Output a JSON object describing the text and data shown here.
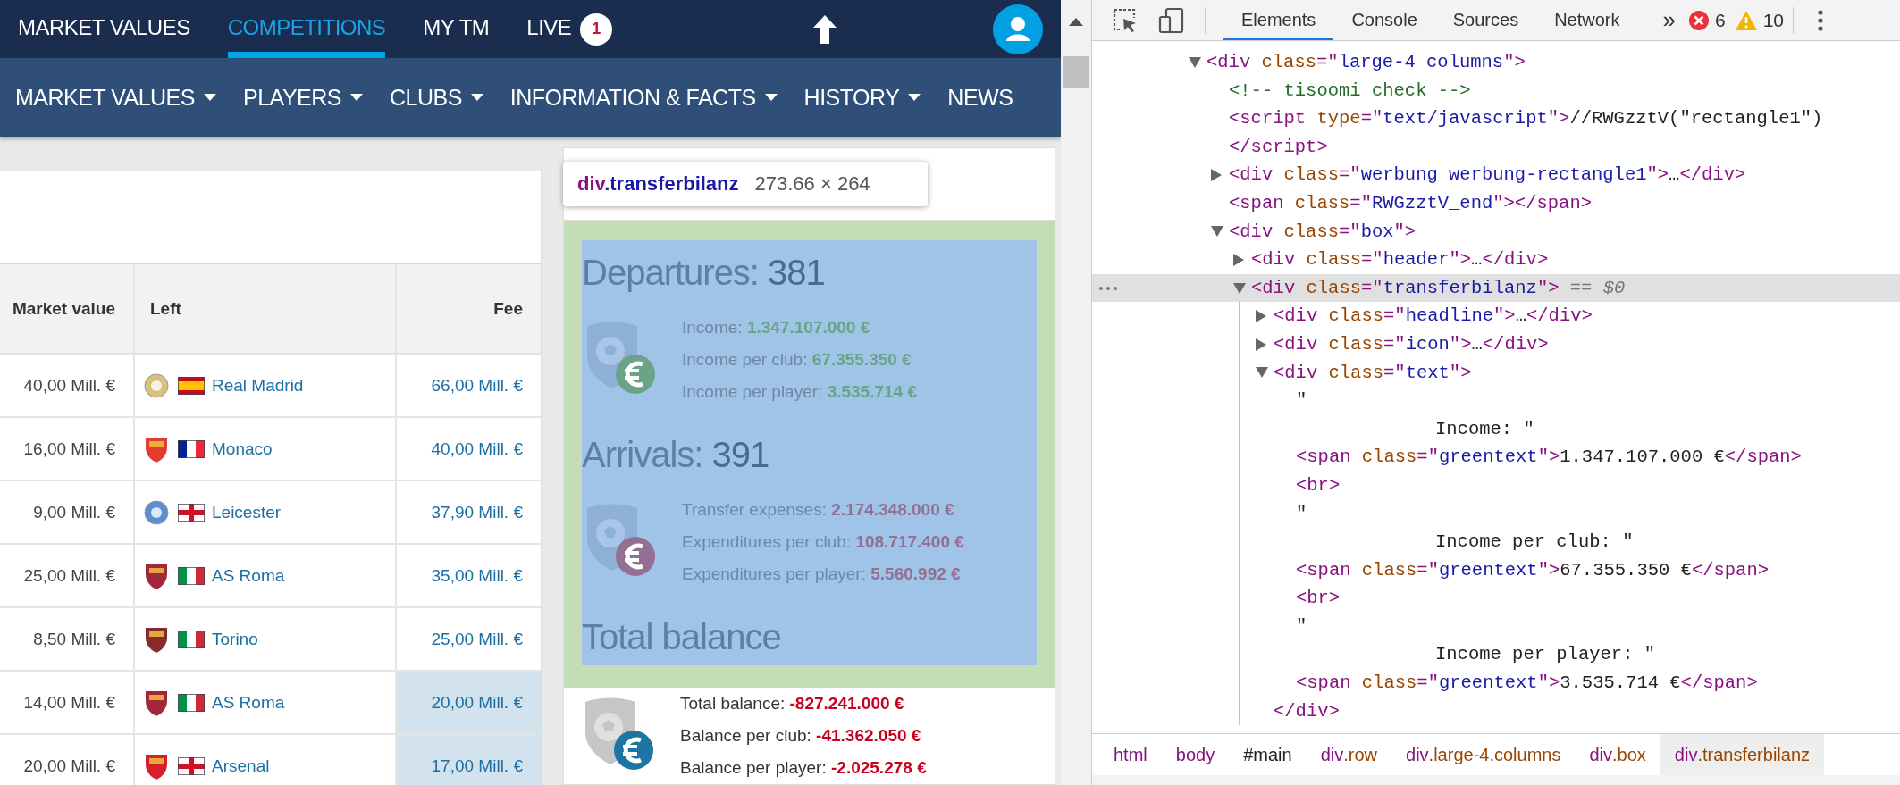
{
  "top_nav": {
    "items": [
      {
        "label": "MARKET VALUES",
        "selected": false
      },
      {
        "label": "COMPETITIONS",
        "selected": true
      },
      {
        "label": "MY TM",
        "selected": false
      },
      {
        "label": "LIVE",
        "selected": false,
        "badge": "1"
      }
    ]
  },
  "sub_nav": {
    "items": [
      {
        "label": "MARKET VALUES",
        "dropdown": true
      },
      {
        "label": "PLAYERS",
        "dropdown": true
      },
      {
        "label": "CLUBS",
        "dropdown": true
      },
      {
        "label": "INFORMATION & FACTS",
        "dropdown": true
      },
      {
        "label": "HISTORY",
        "dropdown": true
      },
      {
        "label": "NEWS",
        "dropdown": false
      }
    ]
  },
  "transfer_table": {
    "columns": [
      "Market value",
      "Left",
      "Fee"
    ],
    "rows": [
      {
        "market_value": "40,00 Mill. €",
        "color": "#d8c27a",
        "club": "Real Madrid",
        "fee": "66,00 Mill. €",
        "highlighted": false
      },
      {
        "market_value": "16,00 Mill. €",
        "color": "#e03c31",
        "club": "Monaco",
        "fee": "40,00 Mill. €",
        "highlighted": false
      },
      {
        "market_value": "9,00 Mill. €",
        "color": "#5b8fd0",
        "club": "Leicester",
        "fee": "37,90 Mill. €",
        "highlighted": false
      },
      {
        "market_value": "25,00 Mill. €",
        "color": "#a3273a",
        "club": "AS Roma",
        "fee": "35,00 Mill. €",
        "highlighted": false
      },
      {
        "market_value": "8,50 Mill. €",
        "color": "#8b2a2a",
        "club": "Torino",
        "fee": "25,00 Mill. €",
        "highlighted": false
      },
      {
        "market_value": "14,00 Mill. €",
        "color": "#a3273b",
        "club": "AS Roma",
        "fee": "20,00 Mill. €",
        "highlighted": true
      },
      {
        "market_value": "20,00 Mill. €",
        "color": "#d4202a",
        "club": "Arsenal",
        "fee": "17,00 Mill. €",
        "highlighted": true
      }
    ]
  },
  "transfer_balance": {
    "tooltip": {
      "tag": "div",
      "class_name": ".transferbilanz",
      "size": "273.66 × 264"
    },
    "departures": {
      "title": "Departures:",
      "count": "381",
      "color": "#6aa387",
      "lines": [
        {
          "label": "Income:",
          "value": "1.347.107.000 €"
        },
        {
          "label": "Income per club:",
          "value": "67.355.350 €"
        },
        {
          "label": "Income per player:",
          "value": "3.535.714 €"
        }
      ]
    },
    "arrivals": {
      "title": "Arrivals:",
      "count": "391",
      "color": "#936f93",
      "lines": [
        {
          "label": "Transfer expenses:",
          "value": "2.174.348.000 €"
        },
        {
          "label": "Expenditures per club:",
          "value": "108.717.400 €"
        },
        {
          "label": "Expenditures per player:",
          "value": "5.560.992 €"
        }
      ]
    },
    "total": {
      "title": "Total balance",
      "color": "#c8001e",
      "lines": [
        {
          "label": "Total balance:",
          "value": "-827.241.000 €"
        },
        {
          "label": "Balance per club:",
          "value": "-41.362.050 €"
        },
        {
          "label": "Balance per player:",
          "value": "-2.025.278 €"
        }
      ]
    }
  },
  "devtools": {
    "tabs": [
      {
        "label": "Elements",
        "selected": true
      },
      {
        "label": "Console",
        "selected": false
      },
      {
        "label": "Sources",
        "selected": false
      },
      {
        "label": "Network",
        "selected": false
      }
    ],
    "more_tabs": "»",
    "errors": "6",
    "warnings": "10",
    "tree": [
      {
        "kind": "element",
        "selected": false,
        "expanded": true,
        "tokens": [
          {
            "kind": "tag",
            "text": "<div"
          },
          {
            "kind": "attr",
            "text": " class"
          },
          {
            "kind": "tag",
            "text": "=\""
          },
          {
            "kind": "value",
            "text": "large-4 columns"
          },
          {
            "kind": "tag",
            "text": "\">"
          }
        ],
        "children": [
          {
            "kind": "comment",
            "selected": false,
            "tokens": [
              {
                "kind": "comment",
                "text": "<!-- tisoomi check -->"
              }
            ]
          },
          {
            "kind": "element",
            "selected": false,
            "tokens": [
              {
                "kind": "tag",
                "text": "<script"
              },
              {
                "kind": "attr",
                "text": " type"
              },
              {
                "kind": "tag",
                "text": "=\""
              },
              {
                "kind": "value",
                "text": "text/javascript"
              },
              {
                "kind": "tag",
                "text": "\">"
              },
              {
                "kind": "plain",
                "text": "//RWGzztV(\"rectangle1\")"
              }
            ],
            "closing": [
              {
                "kind": "tag",
                "text": "</script>"
              }
            ]
          },
          {
            "kind": "element",
            "selected": false,
            "expanded": false,
            "tokens": [
              {
                "kind": "tag",
                "text": "<div"
              },
              {
                "kind": "attr",
                "text": " class"
              },
              {
                "kind": "tag",
                "text": "=\""
              },
              {
                "kind": "value",
                "text": "werbung werbung-rectangle1"
              },
              {
                "kind": "tag",
                "text": "\">"
              },
              {
                "kind": "plain",
                "text": "…"
              },
              {
                "kind": "tag",
                "text": "</div>"
              }
            ]
          },
          {
            "kind": "element",
            "selected": false,
            "tokens": [
              {
                "kind": "tag",
                "text": "<span"
              },
              {
                "kind": "attr",
                "text": " class"
              },
              {
                "kind": "tag",
                "text": "=\""
              },
              {
                "kind": "value",
                "text": "RWGzztV_end"
              },
              {
                "kind": "tag",
                "text": "\"></span>"
              }
            ]
          },
          {
            "kind": "element",
            "selected": false,
            "expanded": true,
            "tokens": [
              {
                "kind": "tag",
                "text": "<div"
              },
              {
                "kind": "attr",
                "text": " class"
              },
              {
                "kind": "tag",
                "text": "=\""
              },
              {
                "kind": "value",
                "text": "box"
              },
              {
                "kind": "tag",
                "text": "\">"
              }
            ],
            "children": [
              {
                "kind": "element",
                "selected": false,
                "expanded": false,
                "tokens": [
                  {
                    "kind": "tag",
                    "text": "<div"
                  },
                  {
                    "kind": "attr",
                    "text": " class"
                  },
                  {
                    "kind": "tag",
                    "text": "=\""
                  },
                  {
                    "kind": "value",
                    "text": "header"
                  },
                  {
                    "kind": "tag",
                    "text": "\">"
                  },
                  {
                    "kind": "plain",
                    "text": "…"
                  },
                  {
                    "kind": "tag",
                    "text": "</div>"
                  }
                ]
              },
              {
                "kind": "element",
                "selected": true,
                "expanded": true,
                "tokens": [
                  {
                    "kind": "tag",
                    "text": "<div"
                  },
                  {
                    "kind": "attr",
                    "text": " class"
                  },
                  {
                    "kind": "tag",
                    "text": "=\""
                  },
                  {
                    "kind": "value",
                    "text": "transferbilanz"
                  },
                  {
                    "kind": "tag",
                    "text": "\">"
                  },
                  {
                    "kind": "meta",
                    "text": " == $0"
                  }
                ],
                "children": [
                  {
                    "kind": "element",
                    "selected": false,
                    "expanded": false,
                    "tokens": [
                      {
                        "kind": "tag",
                        "text": "<div"
                      },
                      {
                        "kind": "attr",
                        "text": " class"
                      },
                      {
                        "kind": "tag",
                        "text": "=\""
                      },
                      {
                        "kind": "value",
                        "text": "headline"
                      },
                      {
                        "kind": "tag",
                        "text": "\">"
                      },
                      {
                        "kind": "plain",
                        "text": "…"
                      },
                      {
                        "kind": "tag",
                        "text": "</div>"
                      }
                    ]
                  },
                  {
                    "kind": "element",
                    "selected": false,
                    "expanded": false,
                    "tokens": [
                      {
                        "kind": "tag",
                        "text": "<div"
                      },
                      {
                        "kind": "attr",
                        "text": " class"
                      },
                      {
                        "kind": "tag",
                        "text": "=\""
                      },
                      {
                        "kind": "value",
                        "text": "icon"
                      },
                      {
                        "kind": "tag",
                        "text": "\">"
                      },
                      {
                        "kind": "plain",
                        "text": "…"
                      },
                      {
                        "kind": "tag",
                        "text": "</div>"
                      }
                    ]
                  },
                  {
                    "kind": "element",
                    "selected": false,
                    "expanded": true,
                    "tokens": [
                      {
                        "kind": "tag",
                        "text": "<div"
                      },
                      {
                        "kind": "attr",
                        "text": " class"
                      },
                      {
                        "kind": "tag",
                        "text": "=\""
                      },
                      {
                        "kind": "value",
                        "text": "text"
                      },
                      {
                        "kind": "tag",
                        "text": "\">"
                      }
                    ],
                    "closing": [
                      {
                        "kind": "tag",
                        "text": "</div>"
                      }
                    ],
                    "children": [
                      {
                        "kind": "text",
                        "selected": false,
                        "lines": [
                          "\"",
                          "Income: \""
                        ]
                      },
                      {
                        "kind": "element",
                        "selected": false,
                        "tokens": [
                          {
                            "kind": "tag",
                            "text": "<span"
                          },
                          {
                            "kind": "attr",
                            "text": " class"
                          },
                          {
                            "kind": "tag",
                            "text": "=\""
                          },
                          {
                            "kind": "value",
                            "text": "greentext"
                          },
                          {
                            "kind": "tag",
                            "text": "\">"
                          },
                          {
                            "kind": "plain",
                            "text": "1.347.107.000 €"
                          },
                          {
                            "kind": "tag",
                            "text": "</span>"
                          }
                        ]
                      },
                      {
                        "kind": "element",
                        "selected": false,
                        "tokens": [
                          {
                            "kind": "tag",
                            "text": "<br>"
                          }
                        ]
                      },
                      {
                        "kind": "text",
                        "selected": false,
                        "lines": [
                          "\"",
                          "Income per club: \""
                        ]
                      },
                      {
                        "kind": "element",
                        "selected": false,
                        "tokens": [
                          {
                            "kind": "tag",
                            "text": "<span"
                          },
                          {
                            "kind": "attr",
                            "text": " class"
                          },
                          {
                            "kind": "tag",
                            "text": "=\""
                          },
                          {
                            "kind": "value",
                            "text": "greentext"
                          },
                          {
                            "kind": "tag",
                            "text": "\">"
                          },
                          {
                            "kind": "plain",
                            "text": "67.355.350 €"
                          },
                          {
                            "kind": "tag",
                            "text": "</span>"
                          }
                        ]
                      },
                      {
                        "kind": "element",
                        "selected": false,
                        "tokens": [
                          {
                            "kind": "tag",
                            "text": "<br>"
                          }
                        ]
                      },
                      {
                        "kind": "text",
                        "selected": false,
                        "lines": [
                          "\"",
                          "Income per player: \""
                        ]
                      },
                      {
                        "kind": "element",
                        "selected": false,
                        "tokens": [
                          {
                            "kind": "tag",
                            "text": "<span"
                          },
                          {
                            "kind": "attr",
                            "text": " class"
                          },
                          {
                            "kind": "tag",
                            "text": "=\""
                          },
                          {
                            "kind": "value",
                            "text": "greentext"
                          },
                          {
                            "kind": "tag",
                            "text": "\">"
                          },
                          {
                            "kind": "plain",
                            "text": "3.535.714 €"
                          },
                          {
                            "kind": "tag",
                            "text": "</span>"
                          }
                        ]
                      }
                    ]
                  }
                ]
              }
            ]
          }
        ]
      }
    ],
    "breadcrumbs": [
      {
        "tokens": [
          {
            "kind": "tag",
            "text": "html"
          }
        ],
        "selected": false
      },
      {
        "tokens": [
          {
            "kind": "tag",
            "text": "body"
          }
        ],
        "selected": false
      },
      {
        "tokens": [
          {
            "kind": "plain",
            "text": "#main"
          }
        ],
        "selected": false
      },
      {
        "tokens": [
          {
            "kind": "tag",
            "text": "div"
          },
          {
            "kind": "attr",
            "text": ".row"
          }
        ],
        "selected": false
      },
      {
        "tokens": [
          {
            "kind": "tag",
            "text": "div"
          },
          {
            "kind": "attr",
            "text": ".large-4.columns"
          }
        ],
        "selected": false
      },
      {
        "tokens": [
          {
            "kind": "tag",
            "text": "div"
          },
          {
            "kind": "attr",
            "text": ".box"
          }
        ],
        "selected": false
      },
      {
        "tokens": [
          {
            "kind": "tag",
            "text": "div"
          },
          {
            "kind": "attr",
            "text": ".transferbilanz"
          }
        ],
        "selected": true
      }
    ]
  }
}
